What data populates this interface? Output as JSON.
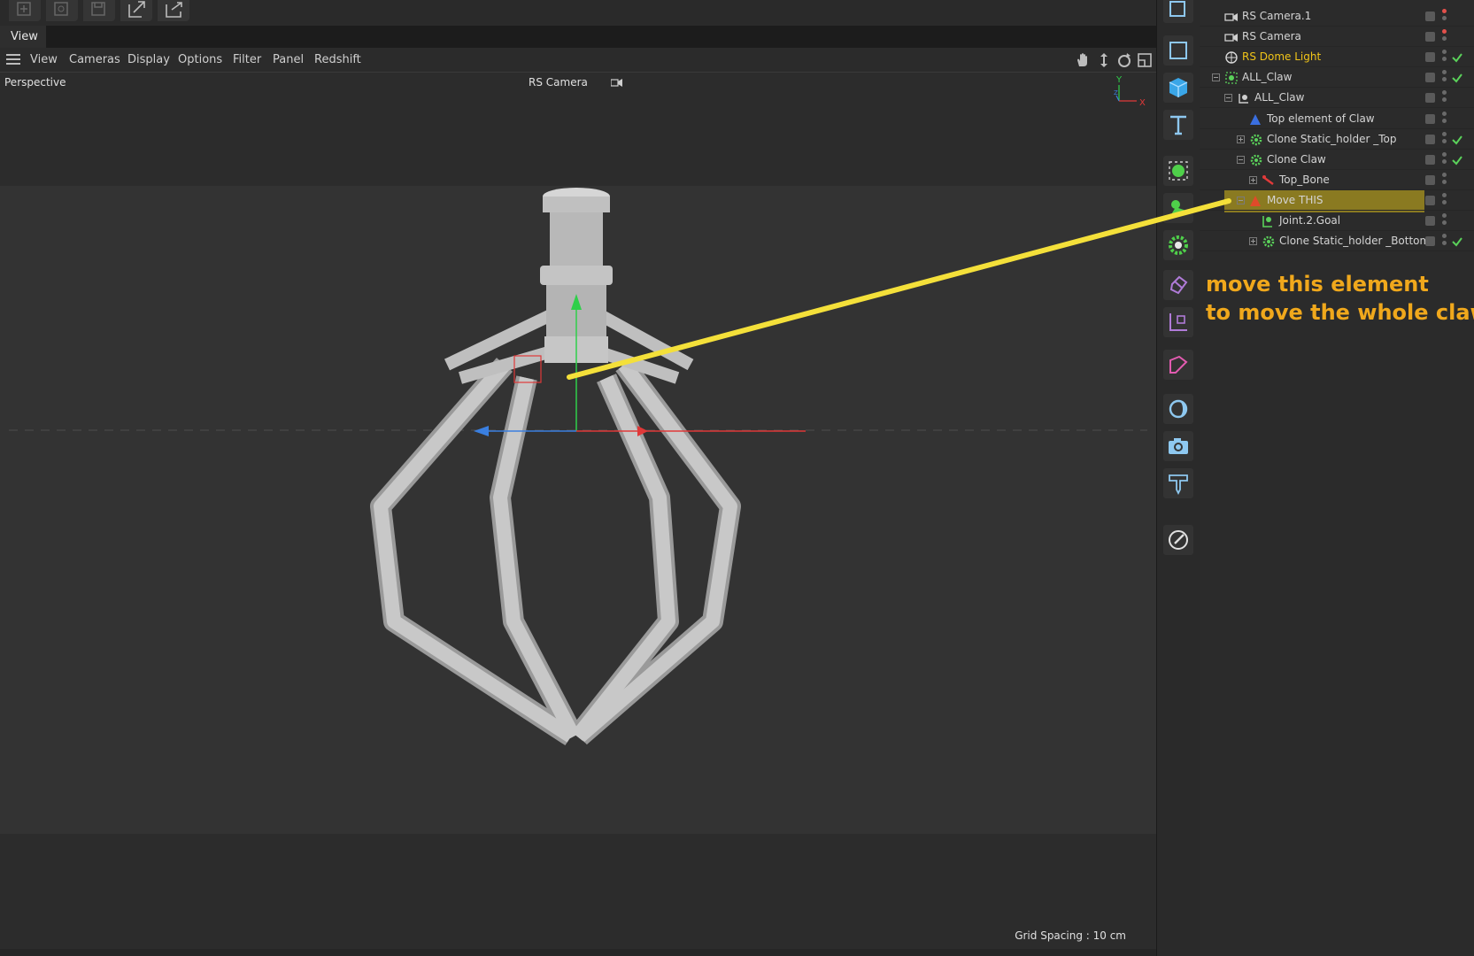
{
  "tab": {
    "label": "View"
  },
  "menu": {
    "items": [
      "View",
      "Cameras",
      "Display",
      "Options",
      "Filter",
      "Panel",
      "Redshift"
    ]
  },
  "viewport": {
    "projection": "Perspective",
    "camera": "RS Camera",
    "grid_spacing": "Grid Spacing : 10 cm",
    "axis_y": "Y",
    "axis_x": "X",
    "axis_z": "Z"
  },
  "toolbar_icons": [
    "new-icon",
    "undo-icon",
    "save-icon",
    "export-icon",
    "share-icon"
  ],
  "palette_icons": [
    "render-region-icon",
    "cube-icon",
    "text-icon",
    "generator-icon",
    "deformer-icon",
    "cogwheel-icon",
    "sculpt-icon",
    "coordinates-icon",
    "spline-icon",
    "light-icon",
    "camera-icon",
    "floor-icon",
    "edit-icon"
  ],
  "objects": [
    {
      "name": "RS Camera.1",
      "indent": 0,
      "icon": "camera-icon",
      "red": true,
      "check": false,
      "tree": ""
    },
    {
      "name": "RS Camera",
      "indent": 0,
      "icon": "camera-icon",
      "red": true,
      "check": false,
      "tree": ""
    },
    {
      "name": "RS Dome Light",
      "indent": 0,
      "icon": "dome-light-icon",
      "red": false,
      "check": true,
      "yellow": true,
      "tree": ""
    },
    {
      "name": "ALL_Claw",
      "indent": 0,
      "icon": "null-green-icon",
      "red": false,
      "check": true,
      "tree": "minus"
    },
    {
      "name": "ALL_Claw",
      "indent": 1,
      "icon": "null-white-icon",
      "red": false,
      "check": false,
      "tree": "minus"
    },
    {
      "name": "Top element of Claw",
      "indent": 2,
      "icon": "blue-cone-icon",
      "red": false,
      "check": false,
      "tree": ""
    },
    {
      "name": "Clone Static_holder _Top",
      "indent": 2,
      "icon": "cloner-icon",
      "red": false,
      "check": true,
      "tree": "plus"
    },
    {
      "name": "Clone Claw",
      "indent": 2,
      "icon": "cloner-icon",
      "red": false,
      "check": true,
      "tree": "minus"
    },
    {
      "name": "Top_Bone",
      "indent": 3,
      "icon": "bone-icon",
      "red": false,
      "check": false,
      "tree": "plus"
    },
    {
      "name": "Move THIS",
      "indent": 2,
      "icon": "red-cone-icon",
      "red": false,
      "check": false,
      "tree": "minus",
      "selected": true
    },
    {
      "name": "Joint.2.Goal",
      "indent": 3,
      "icon": "goal-icon",
      "red": false,
      "check": false,
      "tree": ""
    },
    {
      "name": "Clone Static_holder _Bottom",
      "indent": 3,
      "icon": "cloner-icon",
      "red": false,
      "check": true,
      "tree": "plus"
    }
  ],
  "annotation": {
    "line1": "move this element",
    "line2": "to move the whole claw"
  },
  "colors": {
    "annotation": "#f0a81c",
    "pointer": "#f4e03a",
    "selection": "#8a7a21",
    "dome_light_text": "#f0c418"
  }
}
